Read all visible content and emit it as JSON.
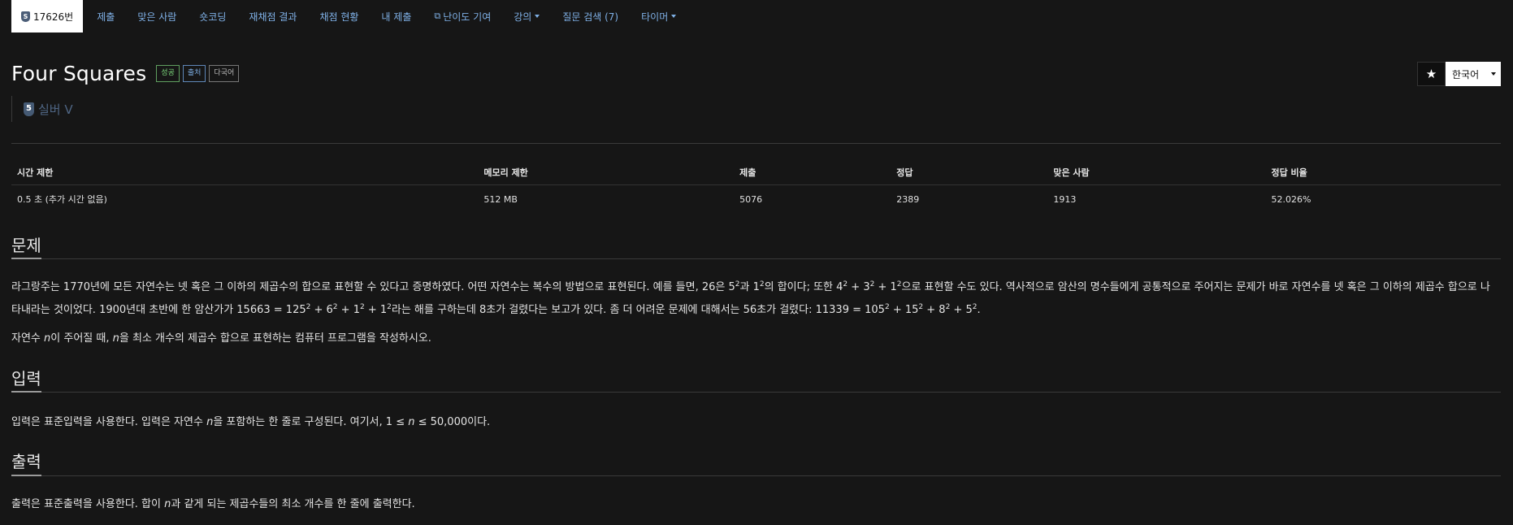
{
  "nav": {
    "active_tab": "17626번",
    "active_badge": "S",
    "links": [
      "제출",
      "맞은 사람",
      "숏코딩",
      "재채점 결과",
      "채점 현황",
      "내 제출"
    ],
    "difficulty_link": "난이도 기여",
    "lecture": "강의",
    "questions": "질문 검색 (7)",
    "timer": "타이머"
  },
  "problem": {
    "title": "Four Squares",
    "labels": [
      "성공",
      "출처",
      "다국어"
    ],
    "tier_badge": "5",
    "tier": "실버 V",
    "language": "한국어",
    "star_icon": "★"
  },
  "stats": {
    "headers": [
      "시간 제한",
      "메모리 제한",
      "제출",
      "정답",
      "맞은 사람",
      "정답 비율"
    ],
    "values": [
      "0.5 초 (추가 시간 없음)",
      "512 MB",
      "5076",
      "2389",
      "1913",
      "52.026%"
    ]
  },
  "sections": {
    "problem_h": "문제",
    "input_h": "입력",
    "output_h": "출력",
    "p1": {
      "a": "라그랑주는 1770년에 모든 자연수는 넷 혹은 그 이하의 제곱수의 합으로 표현할 수 있다고 증명하였다. 어떤 자연수는 복수의 방법으로 표현된다. 예를 들면, 26은 5",
      "b": "과 1",
      "c": "의 합이다; 또한 4",
      "d": " + 3",
      "e": " + 1",
      "f": "으로 표현할 수도 있다. 역사적으로 암산의 명수들에게 공통적으로 주어지는 문제가 바로 자연수를 넷 혹은 그 이하의 제곱수 합으로 나타내라는 것이었다. 1900년대 초반에 한 암산가가 15663 = 125",
      "g": " + 6",
      "h": " + 1",
      "i": " + 1",
      "j": "라는 해를 구하는데 8초가 걸렸다는 보고가 있다. 좀 더 어려운 문제에 대해서는 56초가 걸렸다: 11339 = 105",
      "k": " + 15",
      "l": " + 8",
      "m": " + 5",
      "n": ".",
      "sq": "2"
    },
    "p2": {
      "a": "자연수 ",
      "n1": "n",
      "b": "이 주어질 때, ",
      "n2": "n",
      "c": "을 최소 개수의 제곱수 합으로 표현하는 컴퓨터 프로그램을 작성하시오."
    },
    "input": {
      "a": "입력은 표준입력을 사용한다. 입력은 자연수 ",
      "n1": "n",
      "b": "을 포함하는 한 줄로 구성된다. 여기서, 1 ≤ ",
      "n2": "n",
      "c": " ≤ 50,000이다."
    },
    "output": {
      "a": "출력은 표준출력을 사용한다. 합이 ",
      "n1": "n",
      "b": "과 같게 되는 제곱수들의 최소 개수를 한 줄에 출력한다."
    }
  }
}
